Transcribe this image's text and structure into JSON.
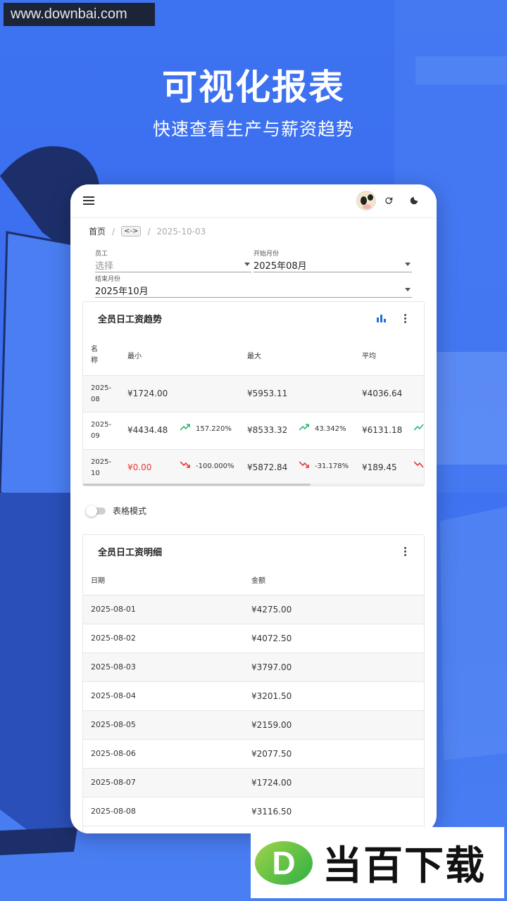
{
  "watermark": "www.downbai.com",
  "headline": "可视化报表",
  "subhead": "快速查看生产与薪资趋势",
  "breadcrumb": {
    "home": "首页",
    "separator": "/",
    "code": "<->",
    "date": "2025-10-03"
  },
  "form": {
    "employee": {
      "label": "员工",
      "placeholder": "选择"
    },
    "start_month": {
      "label": "开始月份",
      "value": "2025年08月"
    },
    "end_month": {
      "label": "结束月份",
      "value": "2025年10月"
    }
  },
  "trend_card": {
    "title": "全员日工资趋势",
    "headers": {
      "name_line1": "名",
      "name_line2": "称",
      "min": "最小",
      "max": "最大",
      "avg": "平均"
    },
    "rows": [
      {
        "name_l1": "2025-",
        "name_l2": "08",
        "min": "¥1724.00",
        "min_change": "",
        "max": "¥5953.11",
        "max_change": "",
        "avg": "¥4036.64"
      },
      {
        "name_l1": "2025-",
        "name_l2": "09",
        "min": "¥4434.48",
        "min_change": "157.220%",
        "max": "¥8533.32",
        "max_change": "43.342%",
        "avg": "¥6131.18"
      },
      {
        "name_l1": "2025-",
        "name_l2": "10",
        "min": "¥0.00",
        "min_change": "-100.000%",
        "max": "¥5872.84",
        "max_change": "-31.178%",
        "avg": "¥189.45"
      }
    ],
    "colors": {
      "up": "#2bb673",
      "down": "#e53935",
      "chart_icon": "#1e6fd8"
    }
  },
  "table_mode_label": "表格模式",
  "detail_card": {
    "title": "全员日工资明细",
    "headers": {
      "date": "日期",
      "amount": "金额"
    },
    "rows": [
      {
        "date": "2025-08-01",
        "amount": "¥4275.00"
      },
      {
        "date": "2025-08-02",
        "amount": "¥4072.50"
      },
      {
        "date": "2025-08-03",
        "amount": "¥3797.00"
      },
      {
        "date": "2025-08-04",
        "amount": "¥3201.50"
      },
      {
        "date": "2025-08-05",
        "amount": "¥2159.00"
      },
      {
        "date": "2025-08-06",
        "amount": "¥2077.50"
      },
      {
        "date": "2025-08-07",
        "amount": "¥1724.00"
      },
      {
        "date": "2025-08-08",
        "amount": "¥3116.50"
      }
    ]
  },
  "icons": {
    "menu": "menu-icon",
    "avatar": "cow-avatar",
    "refresh": "refresh-icon",
    "theme": "dark-mode-icon",
    "chart": "bar-chart-icon",
    "more": "more-vert-icon",
    "trend_up": "trending-up-icon",
    "trend_down": "trending-down-icon"
  },
  "bottom_logo": {
    "letter": "D",
    "text": "当百下载"
  }
}
